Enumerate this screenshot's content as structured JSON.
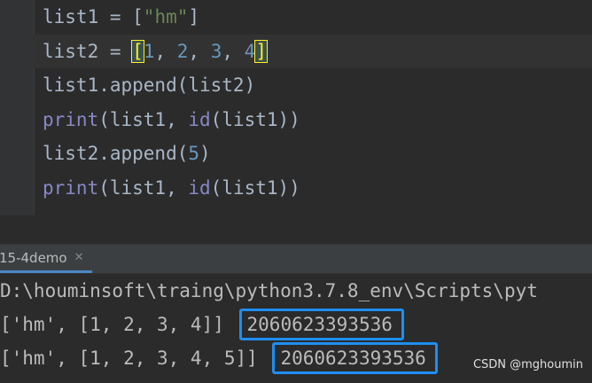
{
  "editor": {
    "lines": [
      {
        "segments": [
          {
            "t": "list1 = [",
            "c": ""
          },
          {
            "t": "\"hm\"",
            "c": "str"
          },
          {
            "t": "]",
            "c": ""
          }
        ]
      },
      {
        "segments": [
          {
            "t": "list2 = ",
            "c": ""
          },
          {
            "t": "[",
            "c": "br"
          },
          {
            "t": "1",
            "c": "num"
          },
          {
            "t": ", ",
            "c": ""
          },
          {
            "t": "2",
            "c": "num"
          },
          {
            "t": ", ",
            "c": ""
          },
          {
            "t": "3",
            "c": "num"
          },
          {
            "t": ", ",
            "c": ""
          },
          {
            "t": "4",
            "c": "num"
          },
          {
            "t": "]",
            "c": "br"
          }
        ]
      },
      {
        "segments": [
          {
            "t": "list1.append(list2)",
            "c": ""
          }
        ]
      },
      {
        "segments": [
          {
            "t": "print",
            "c": "bi"
          },
          {
            "t": "(list1, ",
            "c": ""
          },
          {
            "t": "id",
            "c": "bi"
          },
          {
            "t": "(list1))",
            "c": ""
          }
        ]
      },
      {
        "segments": [
          {
            "t": "list2.append(",
            "c": ""
          },
          {
            "t": "5",
            "c": "num"
          },
          {
            "t": ")",
            "c": ""
          }
        ]
      },
      {
        "segments": [
          {
            "t": "print",
            "c": "bi"
          },
          {
            "t": "(list1, ",
            "c": ""
          },
          {
            "t": "id",
            "c": "bi"
          },
          {
            "t": "(list1))",
            "c": ""
          }
        ]
      }
    ]
  },
  "run_tab": {
    "label": "15-4demo"
  },
  "console": {
    "command": "D:\\houminsoft\\traing\\python3.7.8_env\\Scripts\\pyt",
    "output": [
      {
        "text": "['hm', [1, 2, 3, 4]] ",
        "id": "2060623393536"
      },
      {
        "text": "['hm', [1, 2, 3, 4, 5]] ",
        "id": "2060623393536"
      }
    ]
  },
  "watermark": "CSDN @mghoumin"
}
